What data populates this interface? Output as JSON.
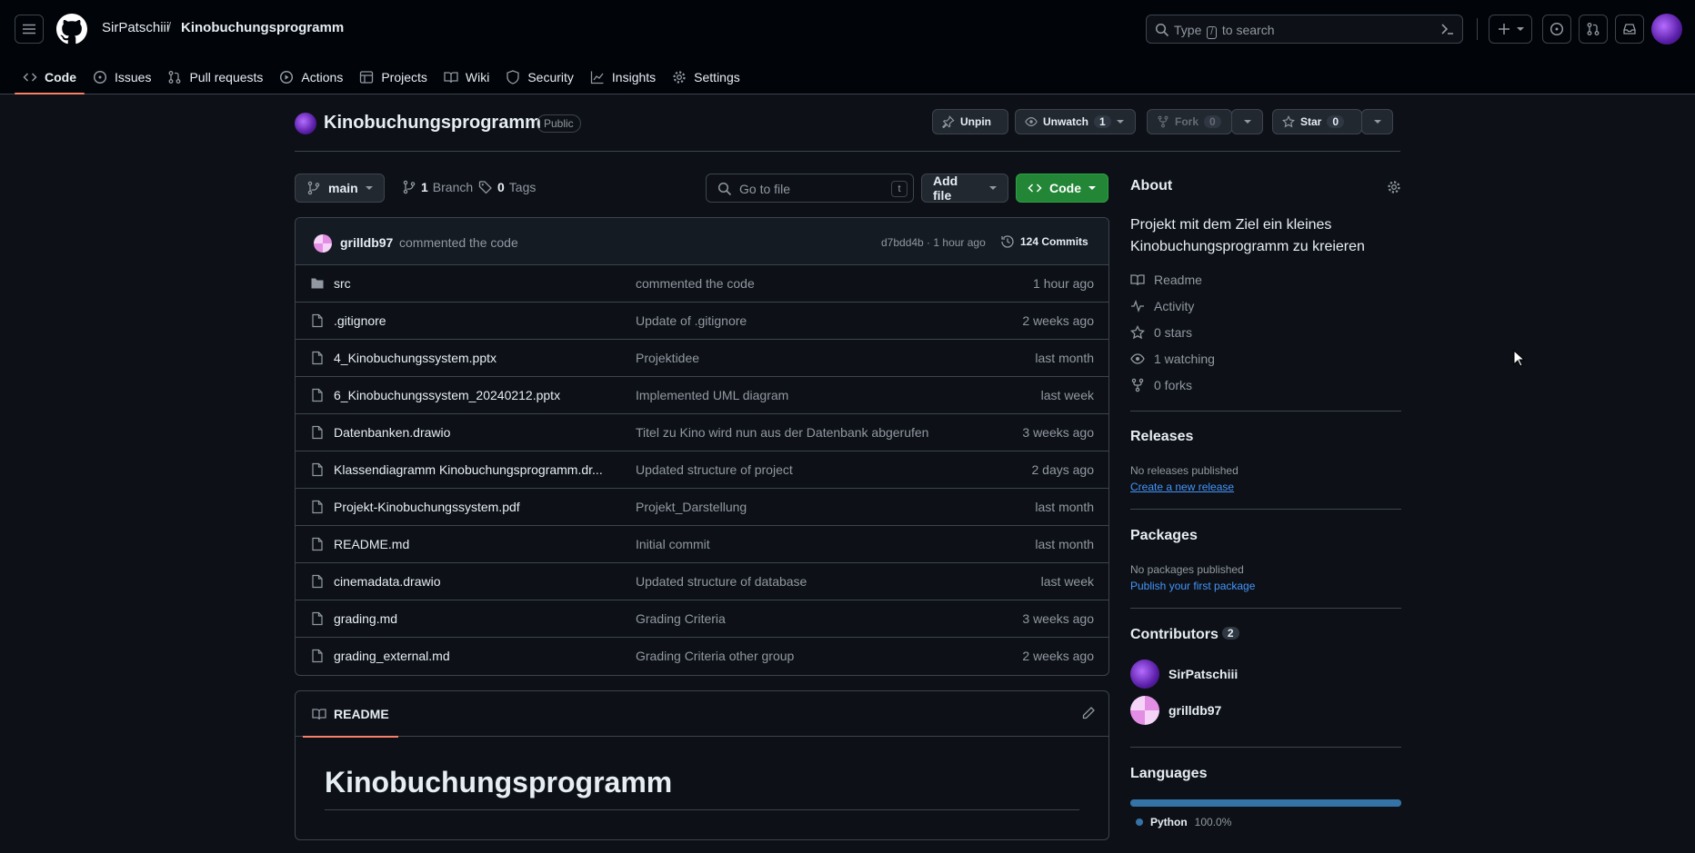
{
  "header": {
    "owner": "SirPatschiii",
    "separator": "/",
    "repo": "Kinobuchungsprogramm",
    "search_placeholder": "Type / to search",
    "search_prefix": "Type",
    "search_key": "/",
    "search_suffix": "to search"
  },
  "tabs": [
    {
      "label": "Code",
      "icon": "code-icon",
      "active": true
    },
    {
      "label": "Issues",
      "icon": "issue-icon"
    },
    {
      "label": "Pull requests",
      "icon": "pull-request-icon"
    },
    {
      "label": "Actions",
      "icon": "play-icon"
    },
    {
      "label": "Projects",
      "icon": "table-icon"
    },
    {
      "label": "Wiki",
      "icon": "book-icon"
    },
    {
      "label": "Security",
      "icon": "shield-icon"
    },
    {
      "label": "Insights",
      "icon": "graph-icon"
    },
    {
      "label": "Settings",
      "icon": "gear-icon"
    }
  ],
  "repo_header": {
    "title": "Kinobuchungsprogramm",
    "visibility": "Public",
    "unpin_label": "Unpin",
    "unwatch_label": "Unwatch",
    "watch_count": "1",
    "fork_label": "Fork",
    "fork_count": "0",
    "star_label": "Star",
    "star_count": "0"
  },
  "branch_bar": {
    "branch": "main",
    "branches_count": "1",
    "branches_label": "Branch",
    "tags_count": "0",
    "tags_label": "Tags",
    "goto_placeholder": "Go to file",
    "goto_key": "t",
    "add_file_label": "Add file",
    "code_label": "Code"
  },
  "latest_commit": {
    "author": "grilldb97",
    "message": "commented the code",
    "hash_time": "d7bdd4b · 1 hour ago",
    "commits_label": "124 Commits"
  },
  "files": [
    {
      "name": "src",
      "type": "folder",
      "message": "commented the code",
      "time": "1 hour ago"
    },
    {
      "name": ".gitignore",
      "type": "file",
      "message": "Update of .gitignore",
      "time": "2 weeks ago"
    },
    {
      "name": "4_Kinobuchungssystem.pptx",
      "type": "file",
      "message": "Projektidee",
      "time": "last month"
    },
    {
      "name": "6_Kinobuchungssystem_20240212.pptx",
      "type": "file",
      "message": "Implemented UML diagram",
      "time": "last week"
    },
    {
      "name": "Datenbanken.drawio",
      "type": "file",
      "message": "Titel zu Kino wird nun aus der Datenbank abgerufen",
      "time": "3 weeks ago"
    },
    {
      "name": "Klassendiagramm Kinobuchungsprogramm.dr...",
      "type": "file",
      "message": "Updated structure of project",
      "time": "2 days ago"
    },
    {
      "name": "Projekt-Kinobuchungssystem.pdf",
      "type": "file",
      "message": "Projekt_Darstellung",
      "time": "last month"
    },
    {
      "name": "README.md",
      "type": "file",
      "message": "Initial commit",
      "time": "last month"
    },
    {
      "name": "cinemadata.drawio",
      "type": "file",
      "message": "Updated structure of database",
      "time": "last week"
    },
    {
      "name": "grading.md",
      "type": "file",
      "message": "Grading Criteria",
      "time": "3 weeks ago"
    },
    {
      "name": "grading_external.md",
      "type": "file",
      "message": "Grading Criteria other group",
      "time": "2 weeks ago"
    }
  ],
  "readme": {
    "tab_label": "README",
    "heading": "Kinobuchungsprogramm"
  },
  "about": {
    "title": "About",
    "description": "Projekt mit dem Ziel ein kleines Kinobuchungsprogramm zu kreieren",
    "readme": "Readme",
    "activity": "Activity",
    "stars": "0 stars",
    "watching": "1 watching",
    "forks": "0 forks"
  },
  "releases": {
    "title": "Releases",
    "empty": "No releases published",
    "link": "Create a new release"
  },
  "packages": {
    "title": "Packages",
    "empty": "No packages published",
    "link": "Publish your first package"
  },
  "contributors": {
    "title": "Contributors",
    "count": "2",
    "people": [
      {
        "name": "SirPatschiii"
      },
      {
        "name": "grilldb97"
      }
    ]
  },
  "languages": {
    "title": "Languages",
    "items": [
      {
        "name": "Python",
        "percent": "100.0%",
        "share": 1.0,
        "color": "#3572a5"
      }
    ]
  },
  "colors": {
    "background": "#0d1117",
    "header_bg": "#010409",
    "accent_tab": "#f78166",
    "code_button": "#238636",
    "link": "#4493f8"
  }
}
